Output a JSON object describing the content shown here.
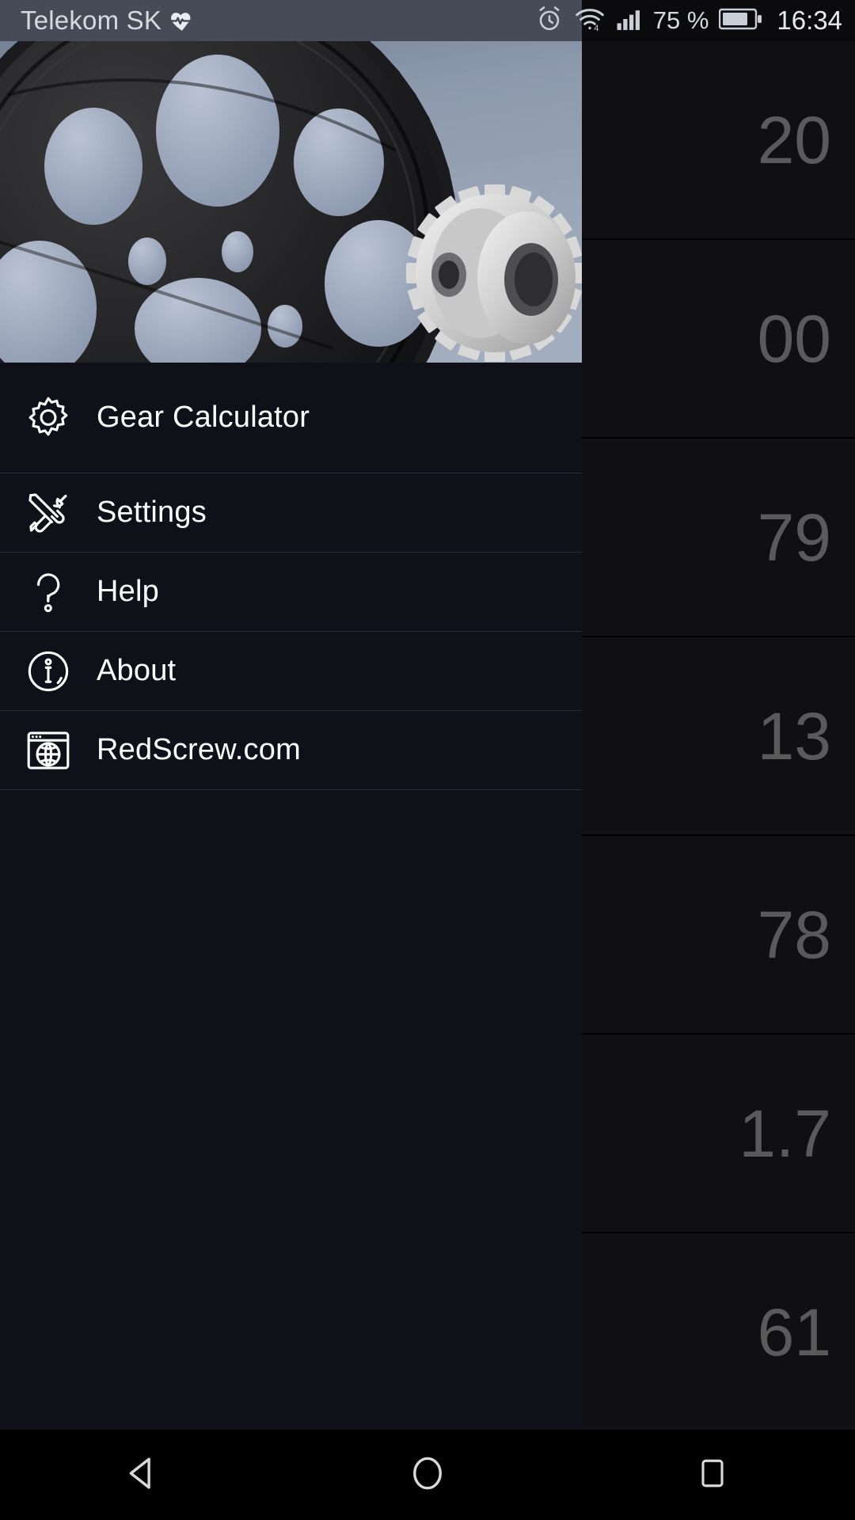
{
  "status_bar": {
    "carrier": "Telekom SK",
    "heart_icon": "heartbeat-icon",
    "alarm_icon": "alarm-clock-icon",
    "wifi_icon": "wifi-icon",
    "signal_icon": "cellular-signal-icon",
    "battery_percent": "75 %",
    "battery_icon": "battery-icon",
    "clock": "16:34",
    "background_color": "#454b57"
  },
  "drawer": {
    "header_image": "gear-wheel-photo",
    "background_color": "#101019",
    "items": [
      {
        "label": "Gear Calculator",
        "icon": "gear-icon"
      },
      {
        "label": "Settings",
        "icon": "tools-icon"
      },
      {
        "label": "Help",
        "icon": "question-mark-icon"
      },
      {
        "label": "About",
        "icon": "info-circle-icon"
      },
      {
        "label": "RedScrew.com",
        "icon": "browser-globe-icon"
      }
    ]
  },
  "background_list": {
    "rows": [
      {
        "value": "20"
      },
      {
        "value": "00"
      },
      {
        "value": "79"
      },
      {
        "value": "13"
      },
      {
        "value": "78"
      },
      {
        "value": "1.7"
      },
      {
        "value": "61"
      }
    ]
  },
  "nav_bar": {
    "buttons": [
      {
        "name": "back",
        "icon": "triangle-back-icon"
      },
      {
        "name": "home",
        "icon": "circle-home-icon"
      },
      {
        "name": "recents",
        "icon": "square-recents-icon"
      }
    ]
  }
}
